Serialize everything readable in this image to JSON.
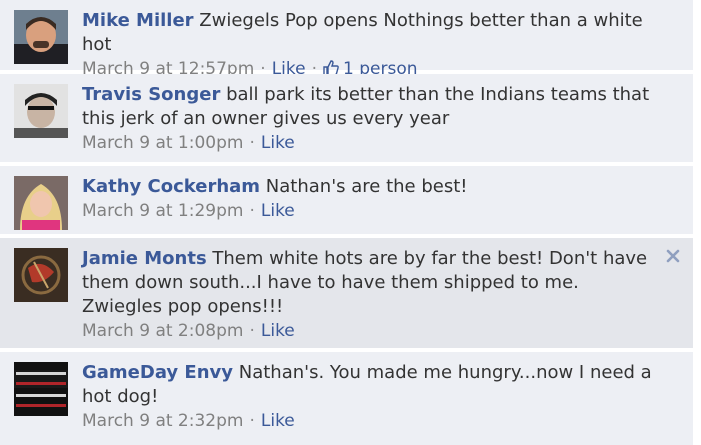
{
  "comments": [
    {
      "author": "Mike Miller",
      "text": "Zwiegels Pop opens Nothings better than a white hot",
      "time": "March 9 at 12:57pm",
      "like_label": "Like",
      "likes_label": "1 person"
    },
    {
      "author": "Travis Songer",
      "text": "ball park its better than the Indians teams that this jerk of an owner gives us every year",
      "time": "March 9 at 1:00pm",
      "like_label": "Like"
    },
    {
      "author": "Kathy Cockerham",
      "text": "Nathan's are the best!",
      "time": "March 9 at 1:29pm",
      "like_label": "Like"
    },
    {
      "author": "Jamie Monts",
      "text": "Them white hots are by far the best! Don't have them down south...I have to have them shipped to me. Zwiegles pop opens!!!",
      "time": "March 9 at 2:08pm",
      "like_label": "Like"
    },
    {
      "author": "GameDay Envy",
      "text": "Nathan's. You made me hungry...now I need a hot dog!",
      "time": "March 9 at 2:32pm",
      "like_label": "Like"
    }
  ],
  "separator": "·",
  "icons": {
    "thumbs_up": "thumbs-up-icon",
    "close": "close-icon"
  },
  "colors": {
    "author": "#3b5998",
    "link": "#3b5998",
    "meta": "#808080",
    "background": "#edeff4",
    "hover_background": "#e4e6eb"
  }
}
